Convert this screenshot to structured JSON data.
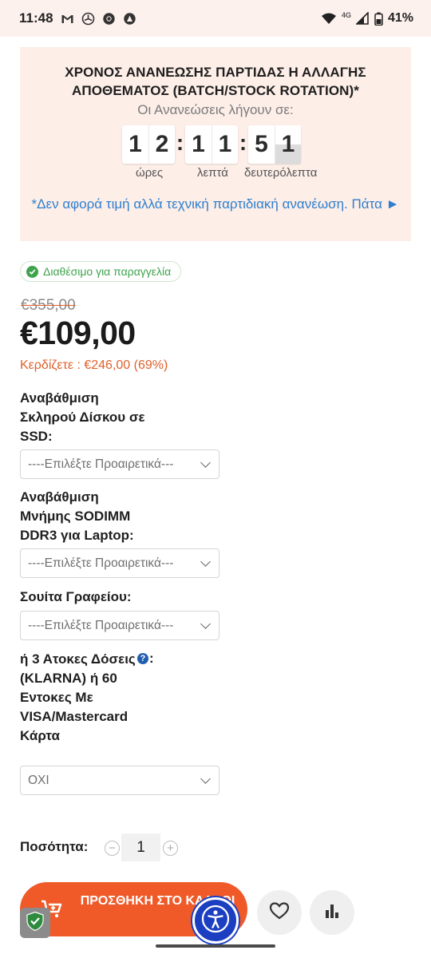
{
  "status_bar": {
    "time": "11:48",
    "network": "4G",
    "battery": "41%",
    "icons": [
      "gmail-icon",
      "pinwheel-icon",
      "chrome-icon",
      "app-icon",
      "wifi-icon",
      "signal-icon",
      "battery-icon"
    ]
  },
  "timer": {
    "title": "ΧΡΟΝΟΣ ΑΝΑΝΕΩΣΗΣ ΠΑΡΤΙΔΑΣ Η ΑΛΛΑΓΗΣ ΑΠΟΘΕΜΑΤΟΣ (BATCH/STOCK ROTATION)*",
    "subtitle": "Οι Ανανεώσεις λήγουν σε:",
    "hours": [
      "1",
      "2"
    ],
    "minutes": [
      "1",
      "1"
    ],
    "seconds": [
      "5",
      "1"
    ],
    "hours_label": "ώρες",
    "minutes_label": "λεπτά",
    "seconds_label": "δευτερόλεπτα",
    "note": "*Δεν αφορά τιμή αλλά τεχνική παρτιδιακή ανανέωση. Πάτα ►"
  },
  "product": {
    "availability": "Διαθέσιμο για παραγγελία",
    "old_price": "€355,00",
    "price": "€109,00",
    "saving": "Κερδίζετε : €246,00 (69%)"
  },
  "options": {
    "ssd_label": "Αναβάθμιση Σκληρού Δίσκου σε SSD:",
    "ssd_value": "----Επιλέξτε Προαιρετικά---",
    "ram_label": "Αναβάθμιση Μνήμης SODIMM DDR3 για Laptop:",
    "ram_value": "----Επιλέξτε Προαιρετικά---",
    "office_label": "Σουίτα Γραφείου:",
    "office_value": "----Επιλέξτε Προαιρετικά---",
    "installments_label": "ή 3 Ατοκες Δόσεις (KLARNA) ή 60 Εντοκες Με VISA/Mastercard Κάρτα",
    "installments_colon": ":",
    "installments_value": "ΟΧΙ"
  },
  "quantity": {
    "label": "Ποσότητα:",
    "value": "1",
    "minus": "−",
    "plus": "+"
  },
  "actions": {
    "add_to_cart": "ΠΡΟΣΘΗΚΗ ΣΤΟ ΚΑΛΑΘΙ"
  },
  "colors": {
    "accent": "#ef5a28",
    "timer_bg": "#fdeee8",
    "available": "#3fa34d",
    "link": "#2e7fce",
    "accessibility": "#1c3fc2"
  }
}
